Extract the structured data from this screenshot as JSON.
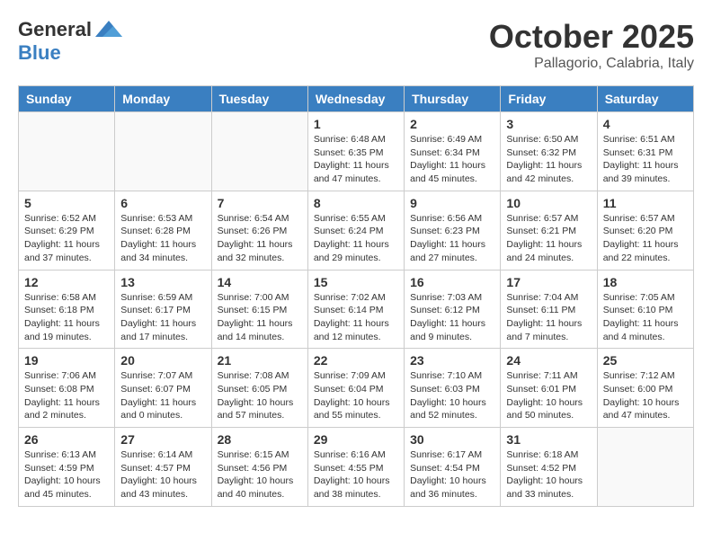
{
  "header": {
    "logo_general": "General",
    "logo_blue": "Blue",
    "month_title": "October 2025",
    "location": "Pallagorio, Calabria, Italy"
  },
  "days_of_week": [
    "Sunday",
    "Monday",
    "Tuesday",
    "Wednesday",
    "Thursday",
    "Friday",
    "Saturday"
  ],
  "weeks": [
    [
      {
        "day": "",
        "info": ""
      },
      {
        "day": "",
        "info": ""
      },
      {
        "day": "",
        "info": ""
      },
      {
        "day": "1",
        "info": "Sunrise: 6:48 AM\nSunset: 6:35 PM\nDaylight: 11 hours\nand 47 minutes."
      },
      {
        "day": "2",
        "info": "Sunrise: 6:49 AM\nSunset: 6:34 PM\nDaylight: 11 hours\nand 45 minutes."
      },
      {
        "day": "3",
        "info": "Sunrise: 6:50 AM\nSunset: 6:32 PM\nDaylight: 11 hours\nand 42 minutes."
      },
      {
        "day": "4",
        "info": "Sunrise: 6:51 AM\nSunset: 6:31 PM\nDaylight: 11 hours\nand 39 minutes."
      }
    ],
    [
      {
        "day": "5",
        "info": "Sunrise: 6:52 AM\nSunset: 6:29 PM\nDaylight: 11 hours\nand 37 minutes."
      },
      {
        "day": "6",
        "info": "Sunrise: 6:53 AM\nSunset: 6:28 PM\nDaylight: 11 hours\nand 34 minutes."
      },
      {
        "day": "7",
        "info": "Sunrise: 6:54 AM\nSunset: 6:26 PM\nDaylight: 11 hours\nand 32 minutes."
      },
      {
        "day": "8",
        "info": "Sunrise: 6:55 AM\nSunset: 6:24 PM\nDaylight: 11 hours\nand 29 minutes."
      },
      {
        "day": "9",
        "info": "Sunrise: 6:56 AM\nSunset: 6:23 PM\nDaylight: 11 hours\nand 27 minutes."
      },
      {
        "day": "10",
        "info": "Sunrise: 6:57 AM\nSunset: 6:21 PM\nDaylight: 11 hours\nand 24 minutes."
      },
      {
        "day": "11",
        "info": "Sunrise: 6:57 AM\nSunset: 6:20 PM\nDaylight: 11 hours\nand 22 minutes."
      }
    ],
    [
      {
        "day": "12",
        "info": "Sunrise: 6:58 AM\nSunset: 6:18 PM\nDaylight: 11 hours\nand 19 minutes."
      },
      {
        "day": "13",
        "info": "Sunrise: 6:59 AM\nSunset: 6:17 PM\nDaylight: 11 hours\nand 17 minutes."
      },
      {
        "day": "14",
        "info": "Sunrise: 7:00 AM\nSunset: 6:15 PM\nDaylight: 11 hours\nand 14 minutes."
      },
      {
        "day": "15",
        "info": "Sunrise: 7:02 AM\nSunset: 6:14 PM\nDaylight: 11 hours\nand 12 minutes."
      },
      {
        "day": "16",
        "info": "Sunrise: 7:03 AM\nSunset: 6:12 PM\nDaylight: 11 hours\nand 9 minutes."
      },
      {
        "day": "17",
        "info": "Sunrise: 7:04 AM\nSunset: 6:11 PM\nDaylight: 11 hours\nand 7 minutes."
      },
      {
        "day": "18",
        "info": "Sunrise: 7:05 AM\nSunset: 6:10 PM\nDaylight: 11 hours\nand 4 minutes."
      }
    ],
    [
      {
        "day": "19",
        "info": "Sunrise: 7:06 AM\nSunset: 6:08 PM\nDaylight: 11 hours\nand 2 minutes."
      },
      {
        "day": "20",
        "info": "Sunrise: 7:07 AM\nSunset: 6:07 PM\nDaylight: 11 hours\nand 0 minutes."
      },
      {
        "day": "21",
        "info": "Sunrise: 7:08 AM\nSunset: 6:05 PM\nDaylight: 10 hours\nand 57 minutes."
      },
      {
        "day": "22",
        "info": "Sunrise: 7:09 AM\nSunset: 6:04 PM\nDaylight: 10 hours\nand 55 minutes."
      },
      {
        "day": "23",
        "info": "Sunrise: 7:10 AM\nSunset: 6:03 PM\nDaylight: 10 hours\nand 52 minutes."
      },
      {
        "day": "24",
        "info": "Sunrise: 7:11 AM\nSunset: 6:01 PM\nDaylight: 10 hours\nand 50 minutes."
      },
      {
        "day": "25",
        "info": "Sunrise: 7:12 AM\nSunset: 6:00 PM\nDaylight: 10 hours\nand 47 minutes."
      }
    ],
    [
      {
        "day": "26",
        "info": "Sunrise: 6:13 AM\nSunset: 4:59 PM\nDaylight: 10 hours\nand 45 minutes."
      },
      {
        "day": "27",
        "info": "Sunrise: 6:14 AM\nSunset: 4:57 PM\nDaylight: 10 hours\nand 43 minutes."
      },
      {
        "day": "28",
        "info": "Sunrise: 6:15 AM\nSunset: 4:56 PM\nDaylight: 10 hours\nand 40 minutes."
      },
      {
        "day": "29",
        "info": "Sunrise: 6:16 AM\nSunset: 4:55 PM\nDaylight: 10 hours\nand 38 minutes."
      },
      {
        "day": "30",
        "info": "Sunrise: 6:17 AM\nSunset: 4:54 PM\nDaylight: 10 hours\nand 36 minutes."
      },
      {
        "day": "31",
        "info": "Sunrise: 6:18 AM\nSunset: 4:52 PM\nDaylight: 10 hours\nand 33 minutes."
      },
      {
        "day": "",
        "info": ""
      }
    ]
  ]
}
